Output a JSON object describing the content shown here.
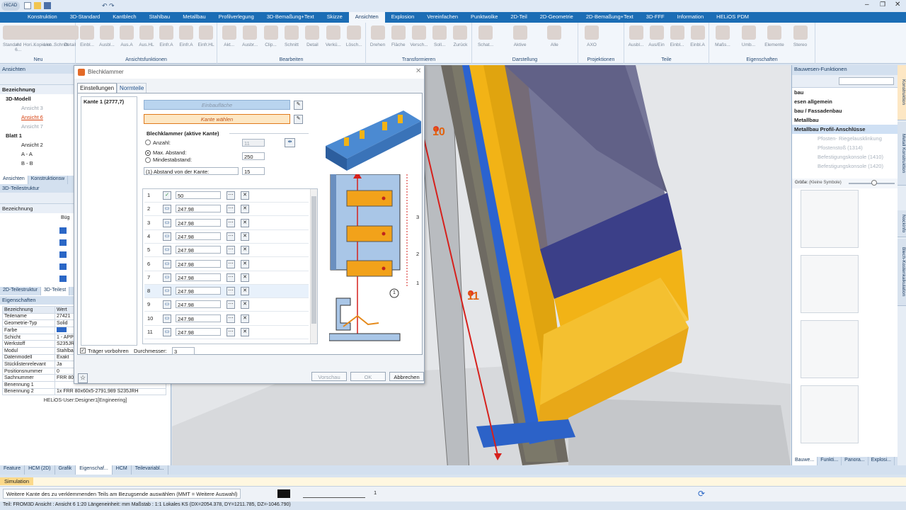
{
  "app": {
    "logo": "HiCAD"
  },
  "menu_tabs": [
    "Konstruktion",
    "3D-Standard",
    "Kantblech",
    "Stahlbau",
    "Metallbau",
    "Profilverlegung",
    "3D-Bemaßung+Text",
    "Skizze",
    "Ansichten",
    "Explosion",
    "Vereinfachen",
    "Punktwolke",
    "2D-Teil",
    "2D-Geometrie",
    "2D-Bemaßung+Text",
    "3D-FFF",
    "Information",
    "HELiOS PDM"
  ],
  "ribbon": {
    "groups": [
      {
        "label": "Neu",
        "buttons": [
          "Standard",
          "4-6...",
          "Hori...",
          "Kopieren",
          "List...",
          "Schnitt",
          "Detail"
        ]
      },
      {
        "label": "Ansichtsfunktionen",
        "buttons": [
          "Einbl...",
          "Ausbl...",
          "Aus.A",
          "Aus.HL",
          "Einfr.A",
          "Einfr.A",
          "Einfr.HL"
        ]
      },
      {
        "label": "Bearbeiten",
        "buttons": [
          "Akt...",
          "Ausbr...",
          "Clip...",
          "Schnitt",
          "Detail",
          "Verkü...",
          "Lösch..."
        ]
      },
      {
        "label": "Transformieren",
        "buttons": [
          "Drehen",
          "Fläche",
          "Versch...",
          "Soll...",
          "Zurück"
        ]
      },
      {
        "label": "Darstellung",
        "buttons": [
          "Schat...",
          "Aktive",
          "Alle"
        ]
      },
      {
        "label": "Projektionen",
        "buttons": [
          "AXO"
        ]
      },
      {
        "label": "Teile",
        "buttons": [
          "Ausbl...",
          "Aus/Ein",
          "Einbl...",
          "Einbl.A"
        ]
      },
      {
        "label": "Eigenschaften",
        "buttons": [
          "Maßs...",
          "Umb...",
          "Elemente",
          "Stereo"
        ]
      }
    ]
  },
  "left": {
    "views_title": "Ansichten",
    "tree_header": "Bezeichnung",
    "tree": [
      "3D-Modell",
      "Ansicht 3",
      "Ansicht 6",
      "Ansicht 7",
      "Blatt 1",
      "Ansicht 2",
      "A - A",
      "B - B"
    ],
    "tabs_top": [
      "Ansichten",
      "Konstruktionsw"
    ],
    "struct_title": "3D-Teilestruktur",
    "struct_header": "Bezeichnung",
    "struct_first": "Büg",
    "tabs_bottom": [
      "2D-Teilestruktur",
      "3D-Teilest"
    ],
    "props_title": "Eigenschaften",
    "props_cols": [
      "Bezeichnung",
      "Wert"
    ],
    "props": [
      [
        "Teilename",
        "27421"
      ],
      [
        "Geometrie-Typ",
        "Solid"
      ],
      [
        "Farbe",
        ""
      ],
      [
        "Schicht",
        "1 - APPLE"
      ],
      [
        "Werkstoff",
        "S235JRH"
      ],
      [
        "Modul",
        "Stahlbau (Profil)"
      ],
      [
        "Datenmodell",
        "Exakt"
      ],
      [
        "Stücklistenrelevant",
        "Ja"
      ],
      [
        "Positionsnummer",
        "0"
      ],
      [
        "Sachnummer",
        "FRR 80x60x5"
      ],
      [
        "Benennung 1",
        ""
      ],
      [
        "Benennung 2",
        "1x FRR 80x60x5-2791,989 S235JRH"
      ]
    ],
    "user": "HELiOS-User:Designer1[Engineering]"
  },
  "dialog": {
    "title": "Blechklammer",
    "tabs": [
      "Einstellungen",
      "Normteile"
    ],
    "edge_item": "Kante 1 (2777,7)",
    "btn_surface": "Einbaufläche",
    "btn_edge": "Kante wählen",
    "group_title": "Blechklammer (aktive Kante)",
    "opt_count": "Anzahl:",
    "count_val": "11",
    "opt_max": "Max. Abstand:",
    "max_val": "250",
    "opt_min": "Mindestabstand:",
    "dist_combo": "(1) Abstand von der Kante:",
    "dist_val": "15",
    "rows": [
      {
        "n": "1",
        "v": "50"
      },
      {
        "n": "2",
        "v": "247.98"
      },
      {
        "n": "3",
        "v": "247.98"
      },
      {
        "n": "4",
        "v": "247.98"
      },
      {
        "n": "5",
        "v": "247.98"
      },
      {
        "n": "6",
        "v": "247.98"
      },
      {
        "n": "7",
        "v": "247.98"
      },
      {
        "n": "8",
        "v": "247.98"
      },
      {
        "n": "9",
        "v": "247.98"
      },
      {
        "n": "10",
        "v": "247.98"
      },
      {
        "n": "11",
        "v": "247.98"
      }
    ],
    "diagram_labels": [
      "3",
      "2",
      "1",
      "1"
    ],
    "chk_drill": "Träger vorbohren",
    "diameter_label": "Durchmesser:",
    "diameter_val": "3",
    "btn_preview": "Vorschau",
    "btn_ok": "OK",
    "btn_cancel": "Abbrechen"
  },
  "viewport": {
    "label_10": "10",
    "label_11": "11"
  },
  "right": {
    "title": "Bauwesen-Funktionen",
    "items": [
      "bau",
      "esen allgemein",
      "bau / Fassadenbau",
      "Metallbau",
      "Metallbau Profil-Anschlüsse",
      "Pfosten- Riegelausklinkung",
      "Pfostenstoß (1314)",
      "Befestigungskonsole (1410)",
      "Befestigungskonsole (1420)"
    ],
    "size_label": "Größe:",
    "size_val": "(Kleine Symbole)",
    "tabs": [
      "Bauwe...",
      "Funkti...",
      "Panora...",
      "Explosi..."
    ],
    "vtabs": [
      "Konstruktion",
      "Metall Konstruktion",
      "Nockinfo",
      "Blech-Kostenkalkulation"
    ]
  },
  "bottom": {
    "tabs": [
      "Feature",
      "HCM (2D)",
      "Grafik",
      "Eigenschaf...",
      "HCM",
      "Teilevariabl..."
    ],
    "sim": "Simulation",
    "prompt": "Weitere Kante des zu verklemmenden Teils am Bezugsende auswählen (MMT = Weitere Auswahl)",
    "line_num": "1",
    "status": "Teil: FROM3D   Ansicht : Ansicht 6 1:20   Längeneinheit: mm   Maßstab : 1:1   Lokales KS   (DX=2054.378, DY=1211.785, DZ=-1046.790)"
  }
}
